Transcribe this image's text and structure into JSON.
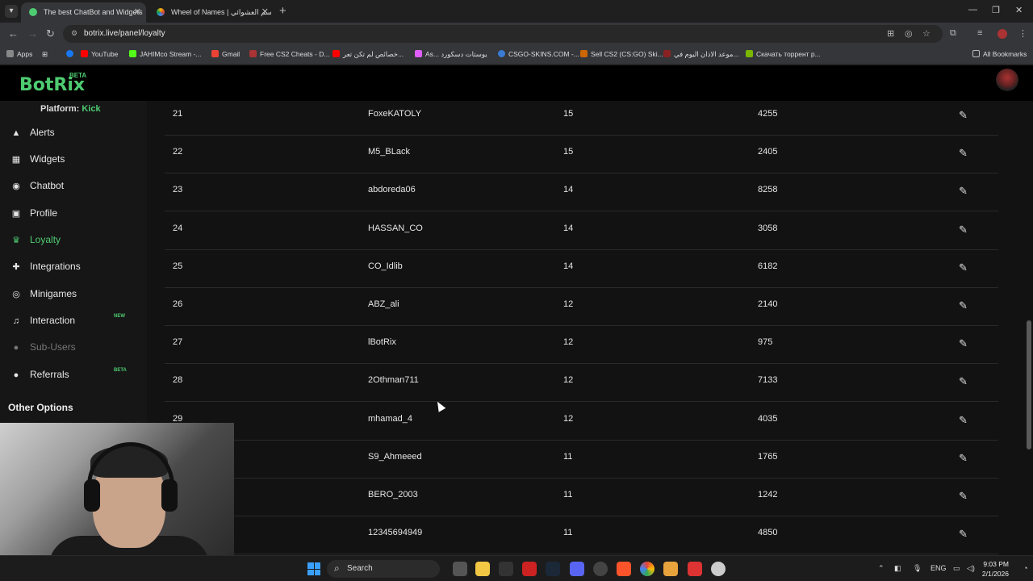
{
  "browser": {
    "tabs": [
      {
        "title": "The best ChatBot and Widgets",
        "active": true,
        "color": "#4ecb71"
      },
      {
        "title": "Wheel of Names | سم العشوائي",
        "active": false,
        "color": "#f4b400"
      }
    ],
    "url": "botrix.live/panel/loyalty",
    "bookmarks": [
      "Apps",
      "YouTube",
      "JAHIMco Stream -...",
      "Gmail",
      "Free CS2 Cheats - D...",
      "خصائص لم تكن تعر...",
      "As... يوستات دسكورد",
      "CSGO-SKINS.COM -...",
      "Sell CS2 (CS:GO) Ski...",
      "موعد الاذان اليوم في...",
      "Скачать торрент р..."
    ],
    "all_bookmarks": "All Bookmarks"
  },
  "app": {
    "logo": "BotRix",
    "beta": "BETA",
    "platform_label": "Platform:",
    "platform_value": "Kick"
  },
  "sidebar": {
    "items": [
      {
        "label": "Alerts",
        "icon": "bell-icon",
        "glyph": "🔔"
      },
      {
        "label": "Widgets",
        "icon": "grid-icon",
        "glyph": "▦"
      },
      {
        "label": "Chatbot",
        "icon": "robot-icon",
        "glyph": "◉"
      },
      {
        "label": "Profile",
        "icon": "id-card-icon",
        "glyph": "▣"
      },
      {
        "label": "Loyalty",
        "icon": "trophy-icon",
        "glyph": "♛"
      },
      {
        "label": "Integrations",
        "icon": "puzzle-icon",
        "glyph": "✚"
      },
      {
        "label": "Minigames",
        "icon": "gamepad-icon",
        "glyph": "◎"
      },
      {
        "label": "Interaction",
        "icon": "music-icon",
        "glyph": "♫"
      },
      {
        "label": "Sub-Users",
        "icon": "users-icon",
        "glyph": "●"
      },
      {
        "label": "Referrals",
        "icon": "user-plus-icon",
        "glyph": "●"
      }
    ],
    "badges": {
      "interaction": "NEW",
      "referrals": "BETA"
    },
    "other_options": "Other Options"
  },
  "table": {
    "rows": [
      {
        "rank": "21",
        "user": "FoxeKATOLY",
        "level": "15",
        "points": "4255"
      },
      {
        "rank": "22",
        "user": "M5_BLack",
        "level": "15",
        "points": "2405"
      },
      {
        "rank": "23",
        "user": "abdoreda06",
        "level": "14",
        "points": "8258"
      },
      {
        "rank": "24",
        "user": "HASSAN_CO",
        "level": "14",
        "points": "3058"
      },
      {
        "rank": "25",
        "user": "CO_Idlib",
        "level": "14",
        "points": "6182"
      },
      {
        "rank": "26",
        "user": "ABZ_ali",
        "level": "12",
        "points": "2140"
      },
      {
        "rank": "27",
        "user": "lBotRix",
        "level": "12",
        "points": "975"
      },
      {
        "rank": "28",
        "user": "2Othman711",
        "level": "12",
        "points": "7133"
      },
      {
        "rank": "29",
        "user": "mhamad_4",
        "level": "12",
        "points": "4035"
      },
      {
        "rank": "",
        "user": "S9_Ahmeeed",
        "level": "11",
        "points": "1765"
      },
      {
        "rank": "",
        "user": "BERO_2003",
        "level": "11",
        "points": "1242"
      },
      {
        "rank": "",
        "user": "12345694949",
        "level": "11",
        "points": "4850"
      }
    ]
  },
  "taskbar": {
    "search": "Search",
    "lang": "ENG",
    "time": "9:03 PM",
    "date": "2/1/2026"
  },
  "colors": {
    "accent": "#4ecb71",
    "background": "#121212",
    "sidebar": "#161616"
  }
}
